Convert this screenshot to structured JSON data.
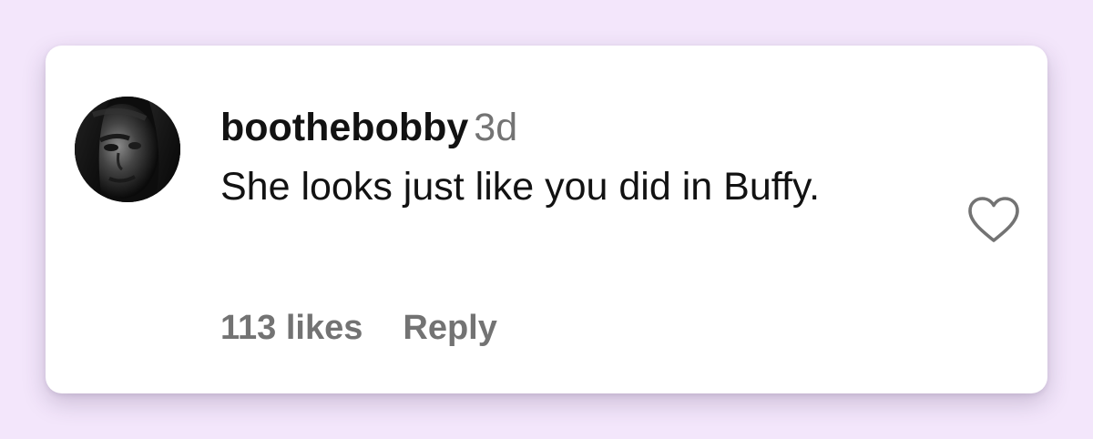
{
  "comment": {
    "username": "boothebobby",
    "timestamp": "3d",
    "text": "She looks just like you did in Buffy.",
    "likes": "113 likes",
    "reply_label": "Reply"
  },
  "icons": {
    "like": "heart-outline-icon",
    "avatar": "profile-photo"
  },
  "colors": {
    "background": "#f3e6fb",
    "card": "#ffffff",
    "text": "#121212",
    "secondary_text": "#737373"
  }
}
